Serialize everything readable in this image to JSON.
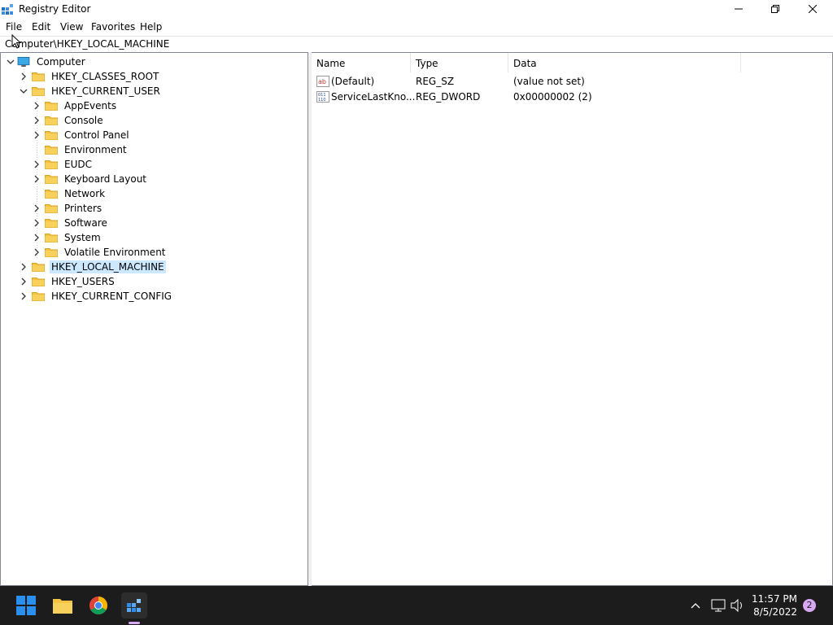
{
  "window": {
    "title": "Registry Editor",
    "menu": [
      "File",
      "Edit",
      "View",
      "Favorites",
      "Help"
    ],
    "address": "Computer\\HKEY_LOCAL_MACHINE"
  },
  "tree": {
    "root": "Computer",
    "items": [
      {
        "label": "HKEY_CLASSES_ROOT",
        "level": 1,
        "expander": "collapsed"
      },
      {
        "label": "HKEY_CURRENT_USER",
        "level": 1,
        "expander": "expanded"
      },
      {
        "label": "AppEvents",
        "level": 2,
        "expander": "collapsed"
      },
      {
        "label": "Console",
        "level": 2,
        "expander": "collapsed"
      },
      {
        "label": "Control Panel",
        "level": 2,
        "expander": "collapsed"
      },
      {
        "label": "Environment",
        "level": 2,
        "expander": "none"
      },
      {
        "label": "EUDC",
        "level": 2,
        "expander": "collapsed"
      },
      {
        "label": "Keyboard Layout",
        "level": 2,
        "expander": "collapsed"
      },
      {
        "label": "Network",
        "level": 2,
        "expander": "none"
      },
      {
        "label": "Printers",
        "level": 2,
        "expander": "collapsed"
      },
      {
        "label": "Software",
        "level": 2,
        "expander": "collapsed"
      },
      {
        "label": "System",
        "level": 2,
        "expander": "collapsed"
      },
      {
        "label": "Volatile Environment",
        "level": 2,
        "expander": "collapsed"
      },
      {
        "label": "HKEY_LOCAL_MACHINE",
        "level": 1,
        "expander": "collapsed",
        "selected": true
      },
      {
        "label": "HKEY_USERS",
        "level": 1,
        "expander": "collapsed"
      },
      {
        "label": "HKEY_CURRENT_CONFIG",
        "level": 1,
        "expander": "collapsed"
      }
    ]
  },
  "list": {
    "columns": [
      "Name",
      "Type",
      "Data"
    ],
    "rows": [
      {
        "icon": "string-value-icon",
        "name": "(Default)",
        "type": "REG_SZ",
        "data": "(value not set)"
      },
      {
        "icon": "binary-value-icon",
        "name": "ServiceLastKno...",
        "type": "REG_DWORD",
        "data": "0x00000002 (2)"
      }
    ]
  },
  "taskbar": {
    "apps": [
      "start-icon",
      "file-explorer-icon",
      "chrome-icon",
      "registry-editor-icon"
    ],
    "time": "11:57 PM",
    "date": "8/5/2022",
    "notification_count": "2"
  },
  "colors": {
    "selection": "#cce8ff",
    "taskbar": "#1c1c1c",
    "folder": "#f5c342",
    "accent": "#0078d4"
  }
}
